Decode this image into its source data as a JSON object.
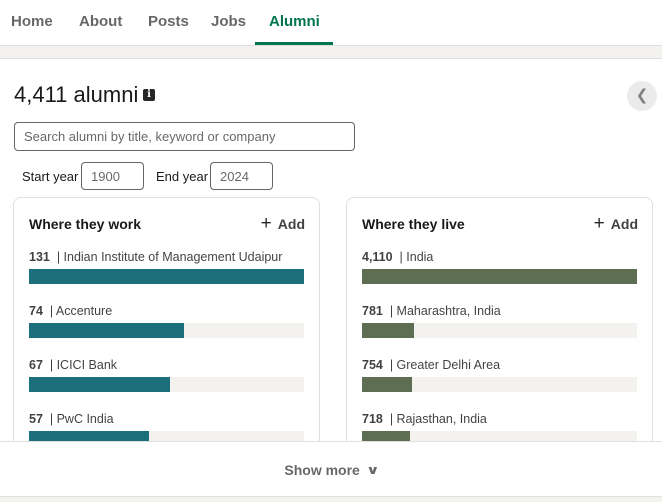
{
  "tabs": [
    {
      "label": "Home"
    },
    {
      "label": "About"
    },
    {
      "label": "Posts"
    },
    {
      "label": "Jobs"
    },
    {
      "label": "Alumni",
      "active": true
    }
  ],
  "header": {
    "count_label": "4,411 alumni",
    "info_icon": "info-icon",
    "collapse_icon": "chevron-left-icon"
  },
  "search": {
    "placeholder": "Search alumni by title, keyword or company",
    "value": ""
  },
  "years": {
    "start_label": "Start year",
    "start_value": "1900",
    "end_label": "End year",
    "end_value": "2024"
  },
  "colors": {
    "accent": "#01754f",
    "work_bar": "#1a6f7b",
    "live_bar": "#5d6e52",
    "track": "#f3f2ef"
  },
  "work_card": {
    "title": "Where they work",
    "add_label": "Add",
    "items": [
      {
        "count": "131",
        "name": "| Indian Institute of Management Udaipur",
        "fraction": 1.0
      },
      {
        "count": "74",
        "name": "| Accenture",
        "fraction": 0.565
      },
      {
        "count": "67",
        "name": "| ICICI Bank",
        "fraction": 0.511
      },
      {
        "count": "57",
        "name": "| PwC India",
        "fraction": 0.435
      }
    ]
  },
  "live_card": {
    "title": "Where they live",
    "add_label": "Add",
    "items": [
      {
        "count": "4,110",
        "name": "| India",
        "fraction": 1.0
      },
      {
        "count": "781",
        "name": "| Maharashtra, India",
        "fraction": 0.19
      },
      {
        "count": "754",
        "name": "| Greater Delhi Area",
        "fraction": 0.183
      },
      {
        "count": "718",
        "name": "| Rajasthan, India",
        "fraction": 0.175
      }
    ]
  },
  "footer": {
    "show_more_label": "Show more",
    "show_more_icon": "chevron-down-icon"
  }
}
